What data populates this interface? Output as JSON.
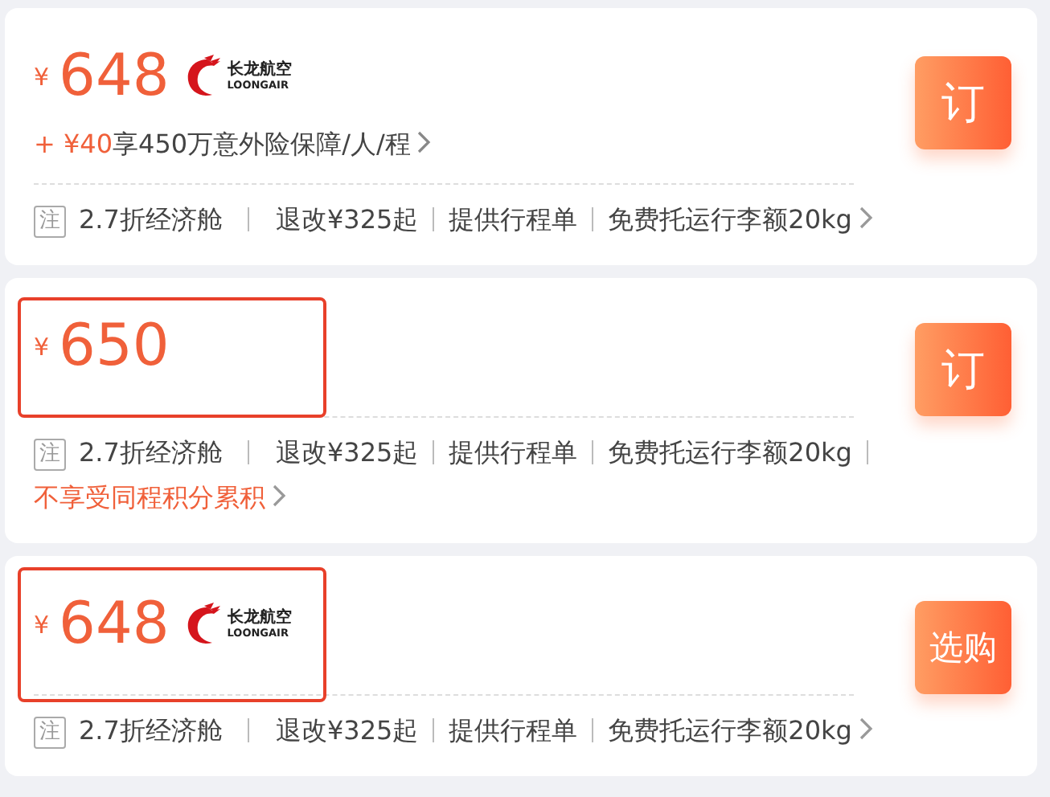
{
  "fares": [
    {
      "currency": "¥",
      "price": "648",
      "airline_logo": {
        "name_cn": "长龙航空",
        "name_en": "LOONGAIR"
      },
      "addon": {
        "price": "+ ¥40",
        "text": "享450万意外险保障/人/程"
      },
      "highlighted": false,
      "tag": "注",
      "features": [
        "2.7折经济舱",
        "退改¥325起",
        "提供行程单",
        "免费托运行李额20kg"
      ],
      "button": "订"
    },
    {
      "currency": "¥",
      "price": "650",
      "highlighted": true,
      "tag": "注",
      "features": [
        "2.7折经济舱",
        "退改¥325起",
        "提供行程单",
        "免费托运行李额20kg"
      ],
      "note": "不享受同程积分累积",
      "button": "订"
    },
    {
      "currency": "¥",
      "price": "648",
      "airline_logo": {
        "name_cn": "长龙航空",
        "name_en": "LOONGAIR"
      },
      "highlighted": true,
      "tag": "注",
      "features": [
        "2.7折经济舱",
        "退改¥325起",
        "提供行程单",
        "免费托运行李额20kg"
      ],
      "button": "选购"
    }
  ]
}
